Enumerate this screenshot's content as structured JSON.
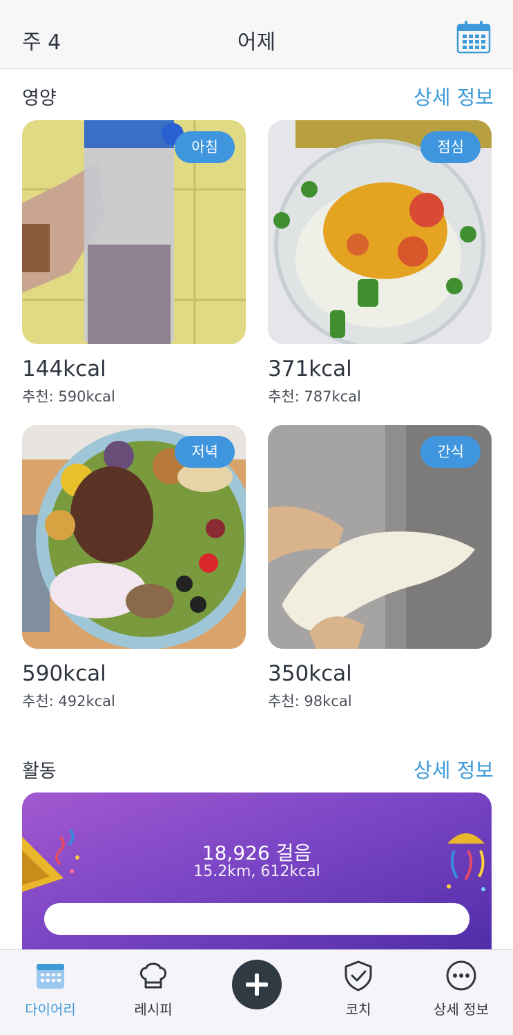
{
  "header": {
    "week": "주 4",
    "title": "어제",
    "calendar_icon": "calendar-icon"
  },
  "nutrition": {
    "title": "영양",
    "detail_link": "상세 정보",
    "meals": [
      {
        "badge": "아침",
        "kcal": "144kcal",
        "recommended": "추천: 590kcal",
        "photo": "protein-shake"
      },
      {
        "badge": "점심",
        "kcal": "371kcal",
        "recommended": "추천: 787kcal",
        "photo": "salad-bowl"
      },
      {
        "badge": "저녁",
        "kcal": "590kcal",
        "recommended": "추천: 492kcal",
        "photo": "steak-salad-plate"
      },
      {
        "badge": "간식",
        "kcal": "350kcal",
        "recommended": "추천: 98kcal",
        "photo": "pear-slice"
      }
    ]
  },
  "activity": {
    "title": "활동",
    "detail_link": "상세 정보",
    "steps": "18,926 걸음",
    "summary": "15.2km, 612kcal",
    "card_gradient": [
      "#a259d0",
      "#4b2aa6"
    ]
  },
  "tabbar": {
    "items": [
      {
        "label": "다이어리",
        "icon": "calendar-icon",
        "active": true
      },
      {
        "label": "레시피",
        "icon": "chef-hat-icon",
        "active": false
      },
      {
        "label": "",
        "icon": "plus-icon",
        "active": false
      },
      {
        "label": "코치",
        "icon": "shield-check-icon",
        "active": false
      },
      {
        "label": "상세 정보",
        "icon": "more-icon",
        "active": false
      }
    ]
  },
  "colors": {
    "accent": "#3d9ad9",
    "badge": "#3f96de",
    "text": "#2f3540",
    "add_button": "#2f3a42"
  }
}
